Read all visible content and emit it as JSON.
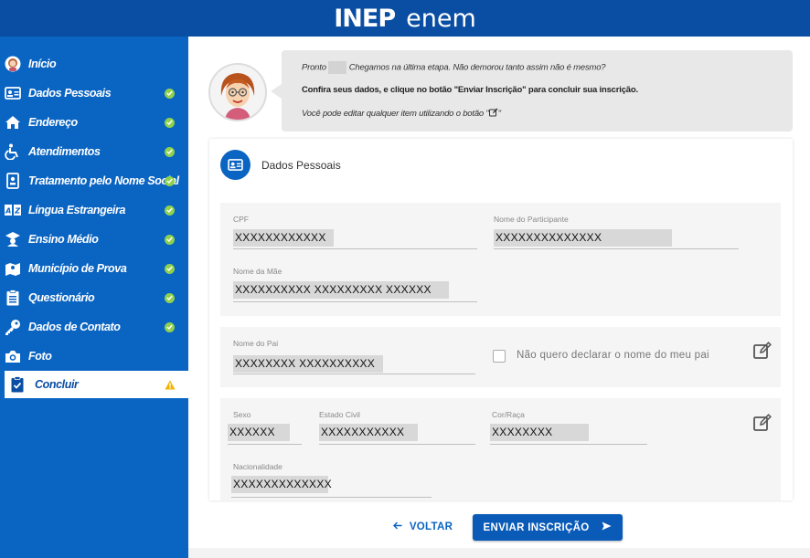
{
  "header": {
    "logo_inep": "INEP",
    "logo_enem": "enem",
    "bg_color": "#0a4ea3"
  },
  "sidebar": {
    "bg_color": "#0a64c2",
    "items": [
      {
        "label": "Início",
        "icon": "user-avatar-icon",
        "status": "none"
      },
      {
        "label": "Dados Pessoais",
        "icon": "id-card-icon",
        "status": "done"
      },
      {
        "label": "Endereço",
        "icon": "home-icon",
        "status": "done"
      },
      {
        "label": "Atendimentos",
        "icon": "wheelchair-icon",
        "status": "done"
      },
      {
        "label": "Tratamento pelo Nome Social",
        "icon": "badge-icon",
        "status": "done"
      },
      {
        "label": "Língua Estrangeira",
        "icon": "language-icon",
        "status": "done"
      },
      {
        "label": "Ensino Médio",
        "icon": "graduation-icon",
        "status": "done"
      },
      {
        "label": "Município de Prova",
        "icon": "map-icon",
        "status": "done"
      },
      {
        "label": "Questionário",
        "icon": "clipboard-list-icon",
        "status": "done"
      },
      {
        "label": "Dados de Contato",
        "icon": "key-icon",
        "status": "done"
      },
      {
        "label": "Foto",
        "icon": "camera-icon",
        "status": "none"
      },
      {
        "label": "Concluir",
        "icon": "clipboard-check-icon",
        "status": "warning",
        "active": true
      }
    ]
  },
  "message": {
    "line1_before": "Pronto",
    "line1_after": "Chegamos na última etapa. Não demorou tanto assim não é mesmo?",
    "line2": "Confira seus dados, e clique no botão \"Enviar Inscrição\" para concluir sua inscrição.",
    "line3_before": "Você pode editar qualquer item utilizando o botão \"",
    "line3_after": "\""
  },
  "section": {
    "title": "Dados Pessoais",
    "fields": {
      "cpf": {
        "label": "CPF",
        "value": "XXXXXXXXXXXX"
      },
      "nome_participante": {
        "label": "Nome do Participante",
        "value": "XXXXXXXXXXXXXX"
      },
      "nome_mae": {
        "label": "Nome da Mãe",
        "value": "XXXXXXXXXX XXXXXXXXX XXXXXX"
      },
      "nome_pai": {
        "label": "Nome do Pai",
        "value": "XXXXXXXX XXXXXXXXXX"
      },
      "nao_declarar_pai": {
        "label": "Não quero declarar o nome do meu pai",
        "checked": false
      },
      "sexo": {
        "label": "Sexo",
        "value": "XXXXXX"
      },
      "estado_civil": {
        "label": "Estado Civil",
        "value": "XXXXXXXXXXX"
      },
      "cor_raca": {
        "label": "Cor/Raça",
        "value": "XXXXXXXX"
      },
      "nacionalidade": {
        "label": "Nacionalidade",
        "value": "XXXXXXXXXXXXX"
      }
    }
  },
  "actions": {
    "back_label": "VOLTAR",
    "submit_label": "ENVIAR INSCRIÇÃO"
  },
  "colors": {
    "accent": "#0a64c2",
    "check_green": "#8fd14f",
    "warning": "#f2b200"
  }
}
